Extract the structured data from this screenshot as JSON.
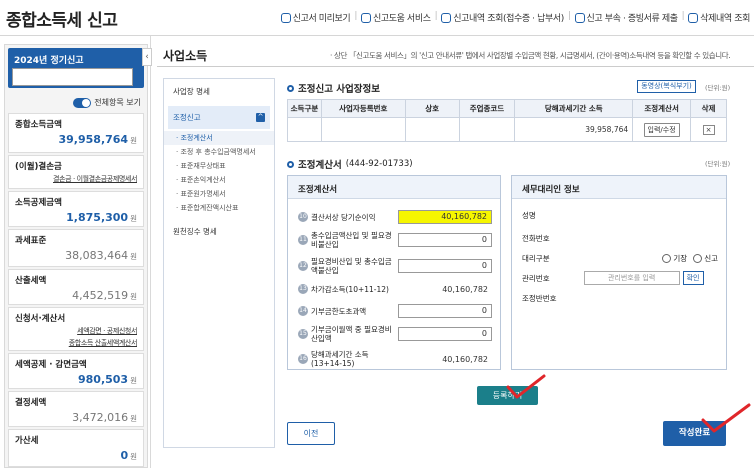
{
  "app": {
    "title": "종합소득세 신고"
  },
  "toplinks": [
    "신고서 미리보기",
    "신고도움 서비스",
    "신고내역 조회(접수증 · 납부서)",
    "신고 부속 · 증빙서류 제출",
    "삭제내역 조회"
  ],
  "left": {
    "year_label": "2024년 정기신고",
    "toggle_label": "전체항목 보기",
    "cards": [
      {
        "title": "종합소득금액",
        "value": "39,958,764",
        "unit": "원"
      },
      {
        "title": "(이월)결손금",
        "link": "결손금 · 이월결손금공제명세서"
      },
      {
        "title": "소득공제금액",
        "value": "1,875,300",
        "unit": "원"
      },
      {
        "title": "과세표준",
        "value": "38,083,464",
        "unit": "원"
      },
      {
        "title": "산출세액",
        "value": "4,452,519",
        "unit": "원"
      },
      {
        "title": "신청서·계산서",
        "link1": "세액감면 · 공제신청서",
        "link2": "종합소득 산출세액계산서"
      },
      {
        "title": "세액공제 · 감면금액",
        "value": "980,503",
        "unit": "원"
      },
      {
        "title": "결정세액",
        "value": "3,472,016",
        "unit": "원"
      },
      {
        "title": "가산세",
        "value": "0",
        "unit": "원"
      }
    ]
  },
  "page": {
    "title": "사업소득",
    "note": "· 상단 「신고도움 서비스」의 '신고 안내서류' 탭에서 사업장별 수입금액 현황, 시급명세서, (간이·용역)소득내역 등을 확인할 수 있습니다.",
    "collapse_icon": "‹"
  },
  "sidenav": {
    "item1": "사업장 명세",
    "item2": "조정신고",
    "item2_icon": "^",
    "subs": [
      "· 조정계산서",
      "· 조정 후 총수입금액명세서",
      "· 표준재무상태표",
      "· 표준손익계산서",
      "· 표준원가명세서",
      "· 표준합계잔액시산표"
    ],
    "item3": "원천징수 명세"
  },
  "bizinfo": {
    "title": "조정신고 사업장정보",
    "unit": "(단위:원)",
    "cert_btn": "동영상(복식부기)",
    "headers": [
      "소득구분",
      "사업자등록번호",
      "상호",
      "주업종코드",
      "당해과세기간 소득",
      "조정계산서",
      "삭제"
    ],
    "row": {
      "income": "39,958,764",
      "btn": "입력/수정",
      "del": "×"
    }
  },
  "calc": {
    "title": "조정계산서",
    "bizno": "(444-92-01733)",
    "unit": "(단위:원)",
    "panel_title": "조정계산서",
    "rows": [
      {
        "n": "10",
        "label": "결산서상 당기순이익",
        "value": "40,160,782"
      },
      {
        "n": "11",
        "label": "총수입금액산입 및 필요경비불산입",
        "value": "0"
      },
      {
        "n": "12",
        "label": "필요경비산입 및 총수입금액불산입",
        "value": "0"
      },
      {
        "n": "13",
        "label": "차가감소득(10+11-12)",
        "value": "40,160,782"
      },
      {
        "n": "14",
        "label": "기부금한도초과액",
        "value": "0"
      },
      {
        "n": "15",
        "label": "기부금이월액 중 필요경비산입액",
        "value": "0"
      },
      {
        "n": "16",
        "label": "당해과세기간 소득 (13+14-15)",
        "value": "40,160,782"
      }
    ],
    "agent_title": "세무대리인 정보",
    "agent": {
      "name": "성명",
      "phone": "전화번호",
      "type": "대리구분",
      "opt1": "기장",
      "opt2": "신고",
      "mgmt": "관리번호",
      "mgmt_placeholder": "관리번호를 입력",
      "check": "확인",
      "team": "조정반번호"
    }
  },
  "buttons": {
    "register": "등록하기",
    "prev": "이전",
    "done": "작성완료"
  },
  "colors": {
    "accent": "#1f5fa8",
    "highlight": "#f6f600",
    "teal": "#1b7f8a",
    "annotation": "#e0262a"
  }
}
